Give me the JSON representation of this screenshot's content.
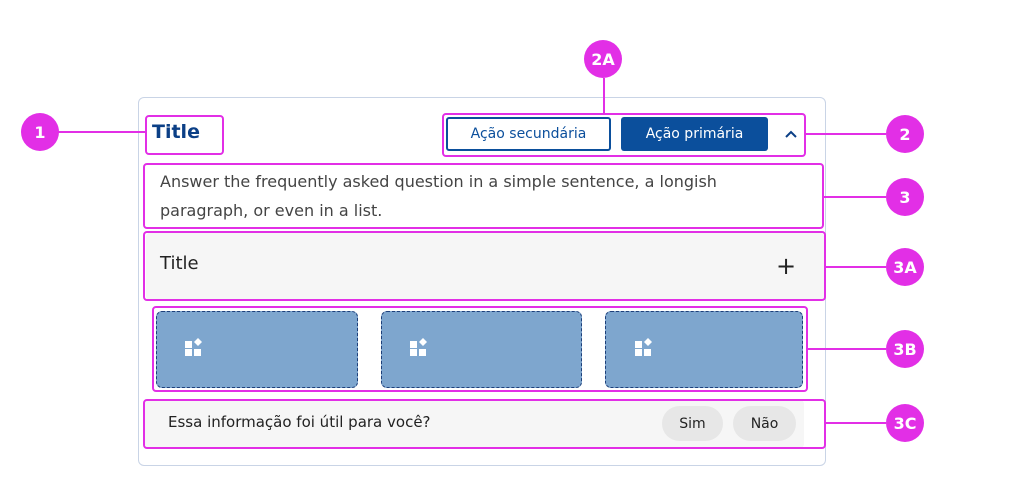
{
  "card": {
    "title": "Title",
    "actions": {
      "secondary_label": "Ação secundária",
      "primary_label": "Ação primária"
    },
    "answer_text": "Answer the frequently asked question in a simple sentence, a longish paragraph, or even in a list.",
    "accordion_title": "Title",
    "tiles": [
      "",
      "",
      ""
    ],
    "feedback": {
      "question": "Essa informação foi útil para você?",
      "yes_label": "Sim",
      "no_label": "Não"
    }
  },
  "markers": {
    "m1": "1",
    "m2": "2",
    "m2a": "2A",
    "m3": "3",
    "m3a": "3A",
    "m3b": "3B",
    "m3c": "3C"
  },
  "colors": {
    "annotation": "#e22fe6",
    "primary": "#0b4f9c",
    "tile": "#7ea6ce",
    "title": "#0b3f86"
  },
  "icons": [
    "chevron-up-icon",
    "plus-icon",
    "widgets-icon"
  ]
}
